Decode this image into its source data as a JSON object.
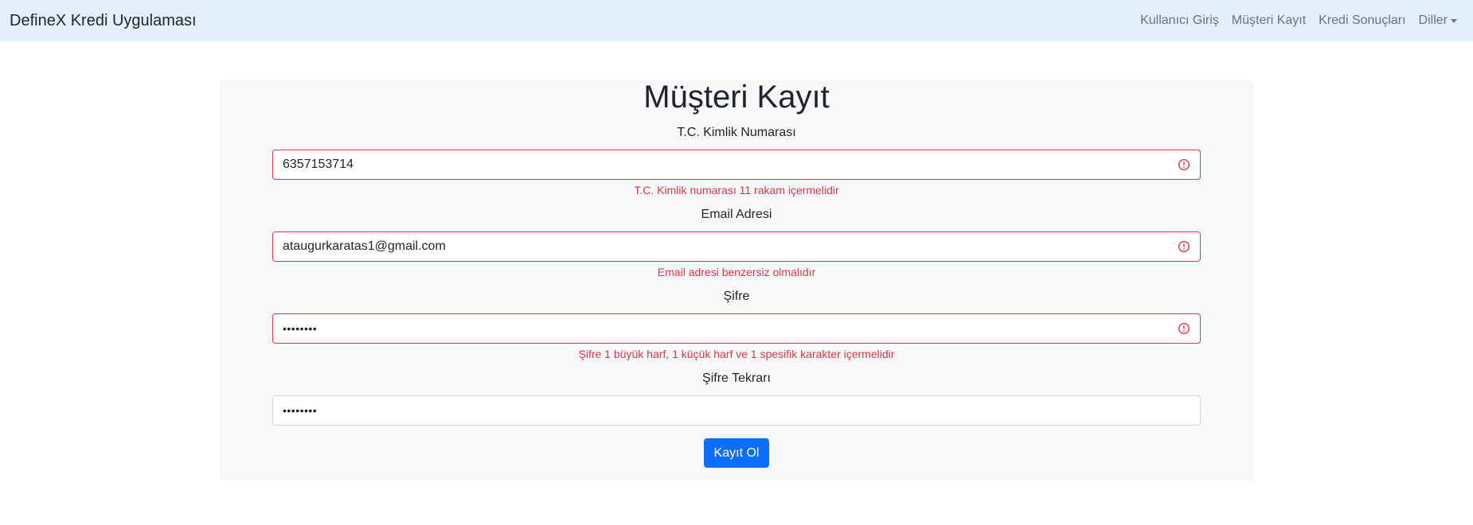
{
  "navbar": {
    "brand": "DefineX Kredi Uygulaması",
    "links": [
      {
        "label": "Kullanıcı Giriş"
      },
      {
        "label": "Müşteri Kayıt"
      },
      {
        "label": "Kredi Sonuçları"
      },
      {
        "label": "Diller"
      }
    ]
  },
  "form": {
    "title": "Müşteri Kayıt",
    "fields": [
      {
        "label": "T.C. Kimlik Numarası",
        "value": "6357153714",
        "error": "T.C. Kimlik numarası 11 rakam içermelidir",
        "invalid": true
      },
      {
        "label": "Email Adresi",
        "value": "ataugurkaratas1@gmail.com",
        "error": "Email adresi benzersiz olmalıdır",
        "invalid": true
      },
      {
        "label": "Şifre",
        "value": "••••••••",
        "error": "Şifre 1 büyük harf, 1 küçük harf ve 1 spesifik karakter içermelidir",
        "invalid": true
      },
      {
        "label": "Şifre Tekrarı",
        "value": "••••••••",
        "error": "",
        "invalid": false
      }
    ],
    "submit_label": "Kayıt Ol"
  },
  "colors": {
    "navbar_bg": "#e2f0fb",
    "error": "#dc3545",
    "primary": "#0d6efd"
  },
  "icons": {
    "invalid_indicator": "exclamation-circle-icon",
    "dropdown": "caret-down-icon"
  }
}
